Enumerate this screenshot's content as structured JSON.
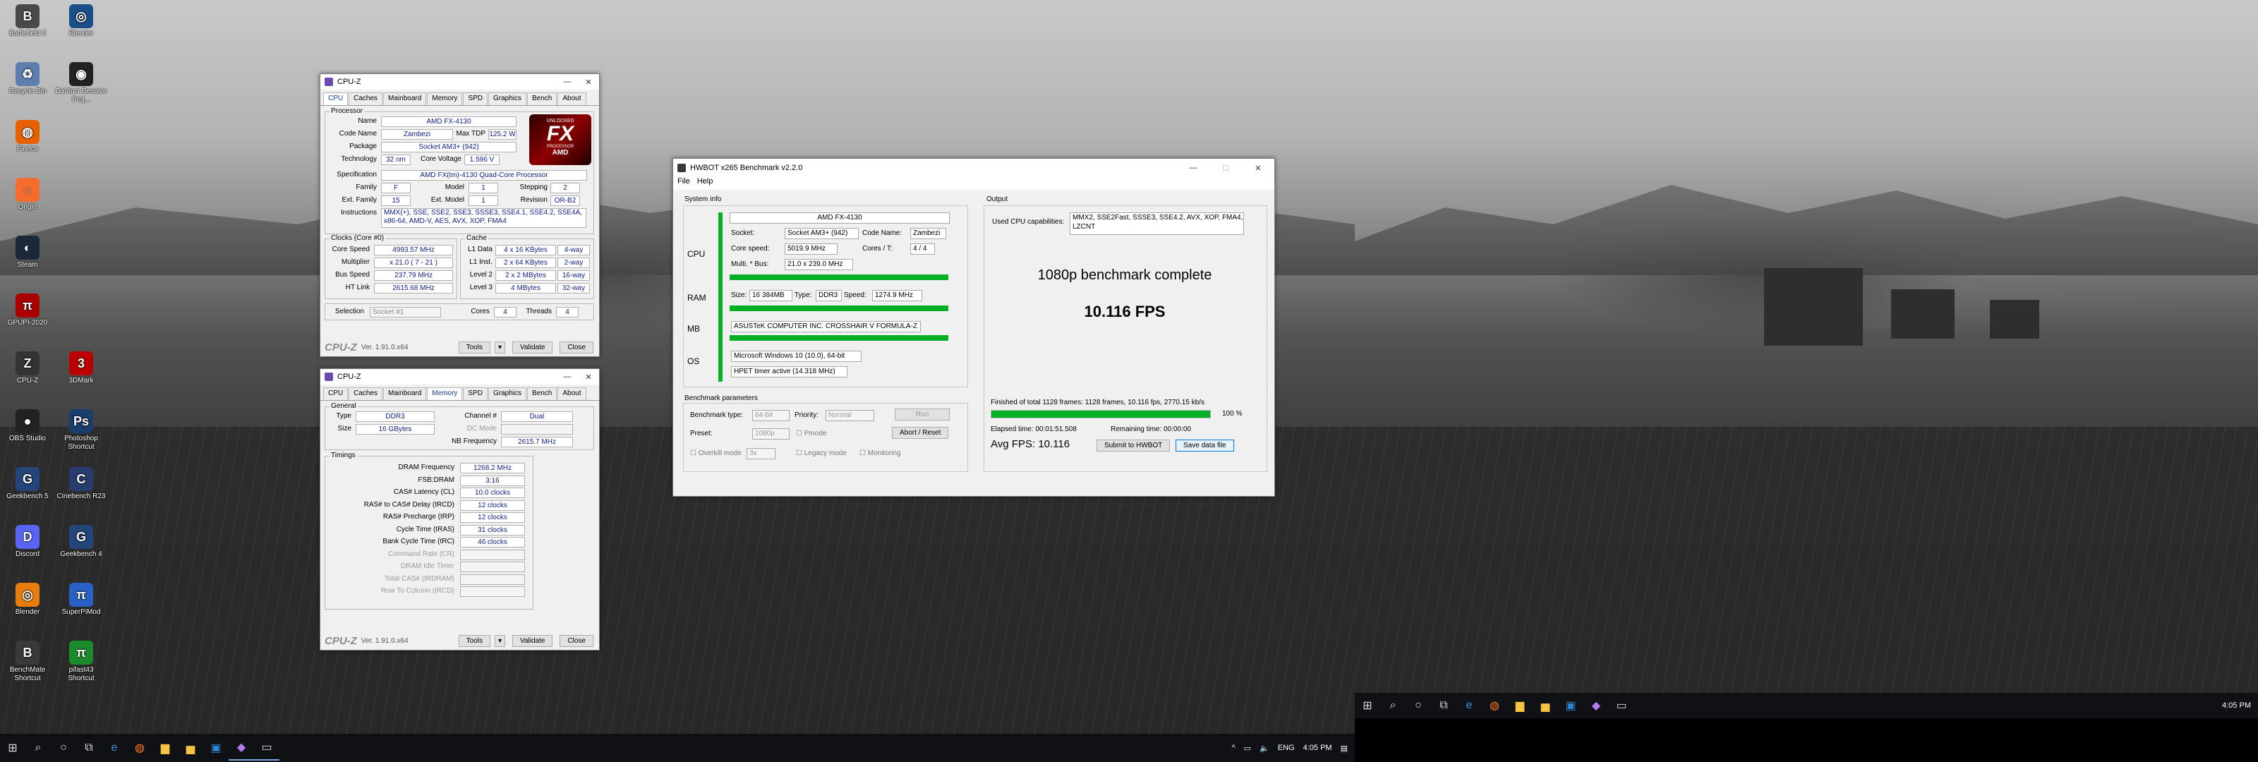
{
  "desktop_icons": [
    {
      "label": "Battlefield 3",
      "color": "#4a4a4a",
      "glyph": "B"
    },
    {
      "label": "Blender",
      "color": "#1b4f8a",
      "glyph": "◎"
    },
    {
      "label": "Recycle Bin",
      "color": "#5c7fb0",
      "glyph": "♻"
    },
    {
      "label": "DaVinci Resolve Proj...",
      "color": "#222",
      "glyph": "◉"
    },
    {
      "label": "Firefox",
      "color": "#e66000",
      "glyph": "◍"
    },
    {
      "label": "Origin",
      "color": "#f56c2d",
      "glyph": "◌"
    },
    {
      "label": "Steam",
      "color": "#1b2838",
      "glyph": "◐"
    },
    {
      "label": "GPUPI-2020",
      "color": "#a00",
      "glyph": "π"
    },
    {
      "label": "3DMark",
      "color": "#b00",
      "glyph": "3"
    },
    {
      "label": "CPU-Z",
      "color": "#333",
      "glyph": "Z"
    },
    {
      "label": "OBS Studio",
      "color": "#222",
      "glyph": "●"
    },
    {
      "label": "Photoshop Shortcut",
      "color": "#1b3d6d",
      "glyph": "Ps"
    },
    {
      "label": "Geekbench 5",
      "color": "#24457a",
      "glyph": "G"
    },
    {
      "label": "Cinebench R23",
      "color": "#283c6e",
      "glyph": "C"
    },
    {
      "label": "Discord",
      "color": "#5865f2",
      "glyph": "D"
    },
    {
      "label": "Geekbench 4",
      "color": "#24457a",
      "glyph": "G"
    },
    {
      "label": "Blender",
      "color": "#e87d0d",
      "glyph": "◎"
    },
    {
      "label": "SuperPiMod",
      "color": "#2962c4",
      "glyph": "π"
    },
    {
      "label": "BenchMate Shortcut",
      "color": "#3a3a3a",
      "glyph": "B"
    },
    {
      "label": "pifast43 Shortcut",
      "color": "#1b8a2b",
      "glyph": "π"
    }
  ],
  "taskbar_left": {
    "icons": [
      "windows-icon",
      "search-icon",
      "cortana-icon",
      "task-view-icon",
      "edge-icon",
      "firefox-icon",
      "explorer-icon",
      "folder-icon",
      "store-icon",
      "cpuz-icon",
      "hwbot-icon"
    ],
    "tray": {
      "chevron": "^",
      "lang": "ENG",
      "time": "4:05 PM"
    }
  },
  "taskbar_right": {
    "tray": {
      "time": "4:05 PM"
    }
  },
  "cpuz_cpu": {
    "title": "CPU-Z",
    "tabs": [
      "CPU",
      "Caches",
      "Mainboard",
      "Memory",
      "SPD",
      "Graphics",
      "Bench",
      "About"
    ],
    "processor": {
      "group": "Processor",
      "name_label": "Name",
      "name": "AMD FX-4130",
      "codename_label": "Code Name",
      "codename": "Zambezi",
      "maxtdp_label": "Max TDP",
      "maxtdp": "125.2 W",
      "package_label": "Package",
      "package": "Socket AM3+ (942)",
      "tech_label": "Technology",
      "tech": "32 nm",
      "voltage_label": "Core Voltage",
      "voltage": "1.596 V",
      "spec_label": "Specification",
      "spec": "AMD FX(tm)-4130 Quad-Core Processor",
      "family_label": "Family",
      "family": "F",
      "model_label": "Model",
      "model": "1",
      "stepping_label": "Stepping",
      "stepping": "2",
      "extfamily_label": "Ext. Family",
      "extfamily": "15",
      "extmodel_label": "Ext. Model",
      "extmodel": "1",
      "revision_label": "Revision",
      "revision": "OR-B2",
      "instr_label": "Instructions",
      "instr": "MMX(+), SSE, SSE2, SSE3, SSSE3, SSE4.1, SSE4.2, SSE4A, x86-64, AMD-V, AES, AVX, XOP, FMA4"
    },
    "logo": {
      "top": "UNLOCKED",
      "main": "FX",
      "sub": "PROCESSOR",
      "brand": "AMD"
    },
    "clocks": {
      "group": "Clocks (Core #0)",
      "corespeed_label": "Core Speed",
      "corespeed": "4993.57 MHz",
      "mult_label": "Multiplier",
      "mult": "x 21.0 ( 7 - 21 )",
      "bus_label": "Bus Speed",
      "bus": "237.79 MHz",
      "ht_label": "HT Link",
      "ht": "2615.68 MHz"
    },
    "cache": {
      "group": "Cache",
      "l1d_label": "L1 Data",
      "l1d": "4 x 16 KBytes",
      "l1d_way": "4-way",
      "l1i_label": "L1 Inst.",
      "l1i": "2 x 64 KBytes",
      "l1i_way": "2-way",
      "l2_label": "Level 2",
      "l2": "2 x 2 MBytes",
      "l2_way": "16-way",
      "l3_label": "Level 3",
      "l3": "4 MBytes",
      "l3_way": "32-way"
    },
    "selection_label": "Selection",
    "selection": "Socket #1",
    "cores_label": "Cores",
    "cores": "4",
    "threads_label": "Threads",
    "threads": "4",
    "footer": {
      "logo": "CPU-Z",
      "version": "Ver. 1.91.0.x64",
      "tools": "Tools",
      "validate": "Validate",
      "close": "Close"
    }
  },
  "cpuz_mem": {
    "title": "CPU-Z",
    "tabs": [
      "CPU",
      "Caches",
      "Mainboard",
      "Memory",
      "SPD",
      "Graphics",
      "Bench",
      "About"
    ],
    "general": {
      "group": "General",
      "type_label": "Type",
      "type": "DDR3",
      "size_label": "Size",
      "size": "16 GBytes",
      "channel_label": "Channel #",
      "channel": "Dual",
      "dcmode_label": "DC Mode",
      "dcmode": "",
      "nbfreq_label": "NB Frequency",
      "nbfreq": "2615.7 MHz"
    },
    "timings": {
      "group": "Timings",
      "rows": [
        {
          "label": "DRAM Frequency",
          "value": "1268.2 MHz",
          "dim": false
        },
        {
          "label": "FSB:DRAM",
          "value": "3:16",
          "dim": false
        },
        {
          "label": "CAS# Latency (CL)",
          "value": "10.0 clocks",
          "dim": false
        },
        {
          "label": "RAS# to CAS# Delay (tRCD)",
          "value": "12 clocks",
          "dim": false
        },
        {
          "label": "RAS# Precharge (tRP)",
          "value": "12 clocks",
          "dim": false
        },
        {
          "label": "Cycle Time (tRAS)",
          "value": "31 clocks",
          "dim": false
        },
        {
          "label": "Bank Cycle Time (tRC)",
          "value": "46 clocks",
          "dim": false
        },
        {
          "label": "Command Rate (CR)",
          "value": "",
          "dim": true
        },
        {
          "label": "DRAM Idle Timer",
          "value": "",
          "dim": true
        },
        {
          "label": "Total CAS# (tRDRAM)",
          "value": "",
          "dim": true
        },
        {
          "label": "Row To Column (tRCD)",
          "value": "",
          "dim": true
        }
      ]
    },
    "footer": {
      "logo": "CPU-Z",
      "version": "Ver. 1.91.0.x64",
      "tools": "Tools",
      "validate": "Validate",
      "close": "Close"
    }
  },
  "hwbot": {
    "title": "HWBOT x265 Benchmark v2.2.0",
    "menu": [
      "File",
      "Help"
    ],
    "sysinfo_label": "System info",
    "cpu_section": "CPU",
    "ram_section": "RAM",
    "mb_section": "MB",
    "os_section": "OS",
    "cpu_name": "AMD FX-4130",
    "socket_label": "Socket:",
    "socket": "Socket AM3+ (942)",
    "codename_label": "Code Name:",
    "codename": "Zambezi",
    "corespeed_label": "Core speed:",
    "corespeed": "5019.9 MHz",
    "cores_label": "Cores / T:",
    "cores": "4 / 4",
    "mult_label": "Multi. * Bus:",
    "mult": "21.0 x 239.0 MHz",
    "size_label": "Size:",
    "size": "16 384MB",
    "type_label": "Type:",
    "type": "DDR3",
    "speed_label": "Speed:",
    "speed": "1274.9 MHz",
    "mb": "ASUSTeK COMPUTER INC. CROSSHAIR V FORMULA-Z",
    "os": "Microsoft Windows 10 (10.0), 64-bit",
    "hpet": "HPET timer active (14.318 MHz)",
    "params_label": "Benchmark parameters",
    "bench_type_label": "Benchmark type:",
    "bench_type": "64-bit",
    "priority_label": "Priority:",
    "priority": "Normal",
    "run": "Run",
    "preset_label": "Preset:",
    "preset": "1080p",
    "pmode_label": "Pmode",
    "about_reset": "Abort / Reset",
    "overkill_label": "Overkill mode",
    "overkill": "3x",
    "legacy_label": "Legacy mode",
    "monitoring_label": "Monitoring",
    "output_label": "Output",
    "caps_label": "Used CPU capabilities:",
    "caps": "MMX2, SSE2Fast, SSSE3, SSE4.2, AVX, XOP, FMA4, LZCNT",
    "complete": "1080p benchmark complete",
    "fps_big": "10.116 FPS",
    "finished": "Finished of total 1128 frames: 1128 frames, 10.116 fps,  2770.15 kb/s",
    "progress": 1.0,
    "progress_text": "100 %",
    "elapsed": "Elapsed time: 00:01:51.508",
    "remaining": "Remaining time: 00:00:00",
    "avg": "Avg FPS: 10.116",
    "submit": "Submit to HWBOT",
    "save": "Save data file"
  }
}
